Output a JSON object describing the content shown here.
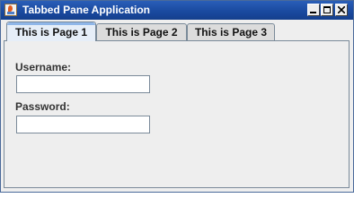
{
  "window": {
    "title": "Tabbed Pane Application",
    "controls": {
      "minimize": "minimize-icon",
      "maximize": "maximize-icon",
      "close": "close-icon"
    }
  },
  "tabs": [
    {
      "label": "This is Page 1",
      "selected": true
    },
    {
      "label": "This is Page 2",
      "selected": false
    },
    {
      "label": "This is Page 3",
      "selected": false
    }
  ],
  "form": {
    "username_label": "Username:",
    "username_value": "",
    "password_label": "Password:",
    "password_value": ""
  },
  "colors": {
    "titlebar": "#1a4aa0",
    "selected_tab_accent": "#8fb6e8",
    "panel_background": "#eeeeee"
  }
}
